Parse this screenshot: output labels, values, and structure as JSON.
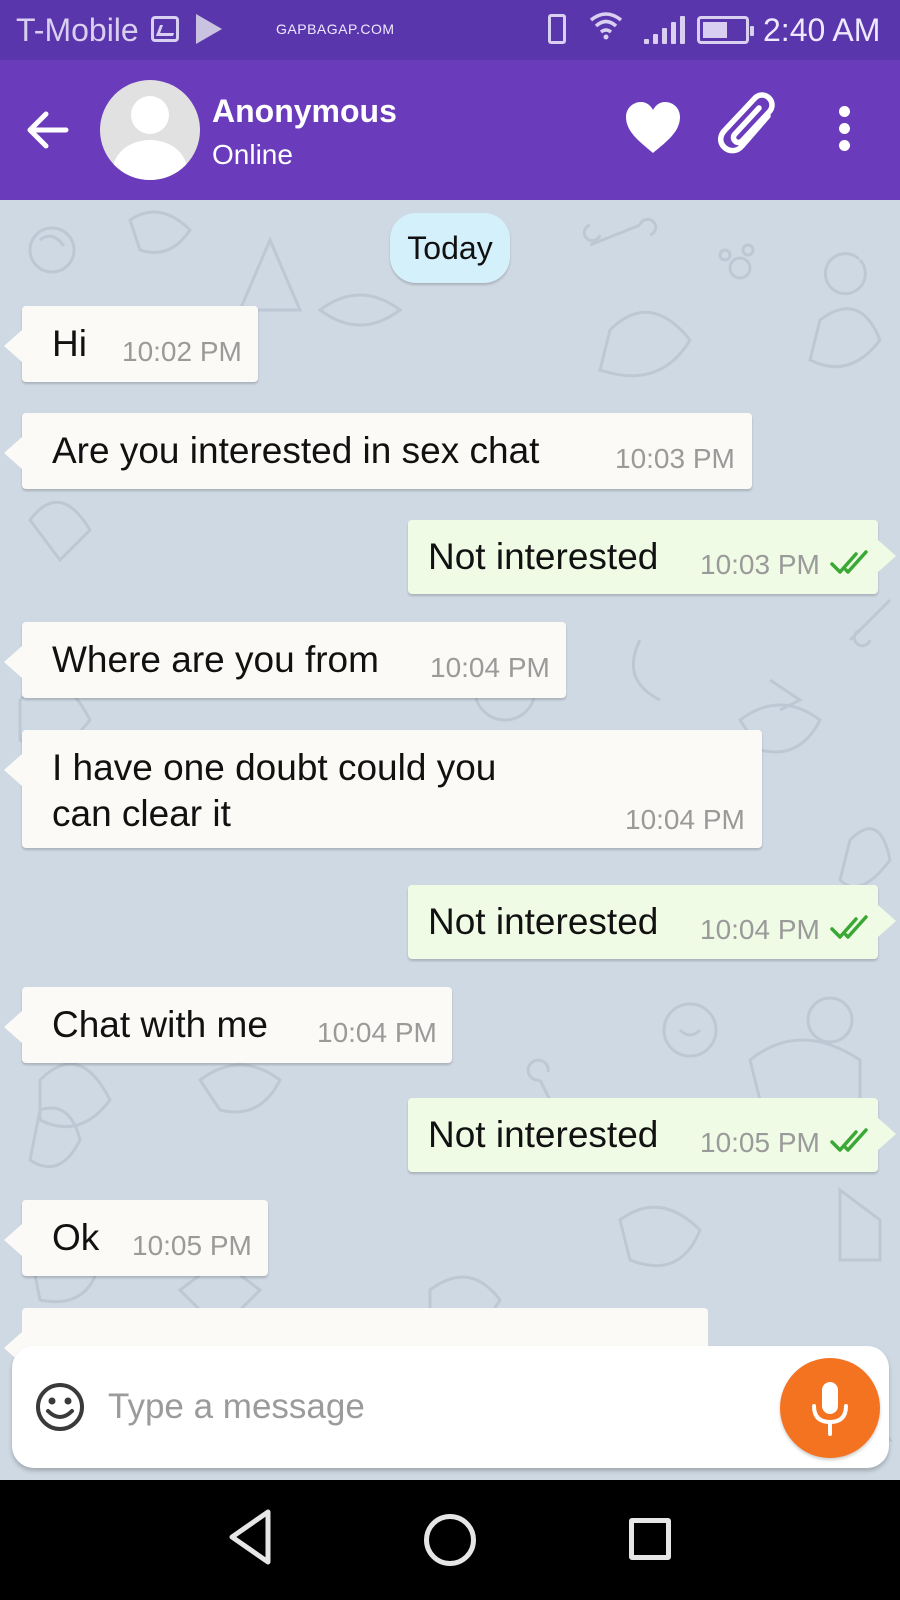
{
  "status_bar": {
    "carrier": "T-Mobile",
    "watermark": "GAPBAGAP.COM",
    "time": "2:40 AM",
    "icons": [
      "gallery-icon",
      "play-store-icon",
      "vibrate-icon",
      "wifi-icon",
      "signal-icon",
      "battery-icon"
    ],
    "battery_level": 0.5
  },
  "header": {
    "contact_name": "Anonymous",
    "contact_status": "Online",
    "icons": [
      "back-arrow-icon",
      "avatar-placeholder",
      "heart-icon",
      "paperclip-icon",
      "more-vertical-icon"
    ]
  },
  "chat": {
    "date_label": "Today",
    "messages": [
      {
        "direction": "in",
        "lines": [
          "Hi"
        ],
        "time": "10:02 PM"
      },
      {
        "direction": "in",
        "lines": [
          "Are you interested  in sex chat"
        ],
        "time": "10:03 PM"
      },
      {
        "direction": "out",
        "lines": [
          "Not interested"
        ],
        "time": "10:03 PM",
        "status": "read"
      },
      {
        "direction": "in",
        "lines": [
          "Where are you from"
        ],
        "time": "10:04 PM"
      },
      {
        "direction": "in",
        "lines": [
          "I have one doubt could you",
          "can clear it"
        ],
        "time": "10:04 PM"
      },
      {
        "direction": "out",
        "lines": [
          "Not interested"
        ],
        "time": "10:04 PM",
        "status": "read"
      },
      {
        "direction": "in",
        "lines": [
          "Chat with me"
        ],
        "time": "10:04 PM"
      },
      {
        "direction": "out",
        "lines": [
          "Not interested"
        ],
        "time": "10:05 PM",
        "status": "read"
      },
      {
        "direction": "in",
        "lines": [
          "Ok"
        ],
        "time": "10:05 PM"
      }
    ]
  },
  "composer": {
    "placeholder": "Type a message",
    "value": "",
    "icons": [
      "emoji-icon",
      "mic-icon"
    ]
  },
  "nav_bar": {
    "icons": [
      "nav-back-icon",
      "nav-home-icon",
      "nav-recents-icon"
    ]
  },
  "colors": {
    "status_bar": "#5a36ac",
    "header": "#6a3cbc",
    "chat_background": "#cfd9e3",
    "incoming_bubble": "#fbfaf6",
    "outgoing_bubble": "#f0fbe6",
    "date_chip": "#d3f0fb",
    "read_ticks": "#3aa835",
    "mic_button": "#f47321"
  }
}
